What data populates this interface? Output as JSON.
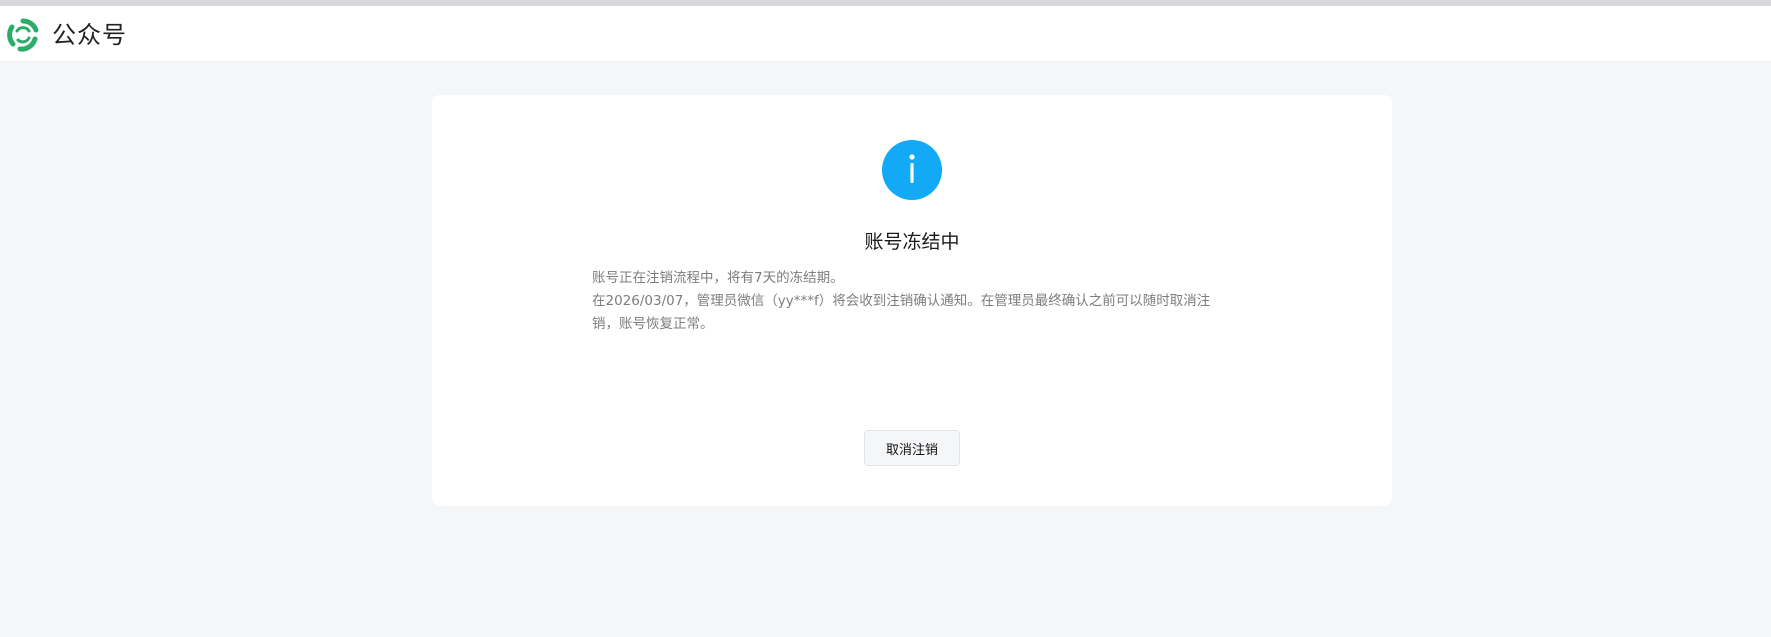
{
  "header": {
    "brand": "公众号"
  },
  "notice": {
    "icon": "info-icon",
    "icon_color": "#12a9f6",
    "title": "账号冻结中",
    "line1": "账号正在注销流程中，将有7天的冻结期。",
    "line2": "在2026/03/07，管理员微信（yy***f）将会收到注销确认通知。在管理员最终确认之前可以随时取消注销，账号恢复正常。",
    "cancel_label": "取消注销"
  },
  "colors": {
    "brand_green": "#2aae67",
    "background": "#f5f6f8"
  }
}
